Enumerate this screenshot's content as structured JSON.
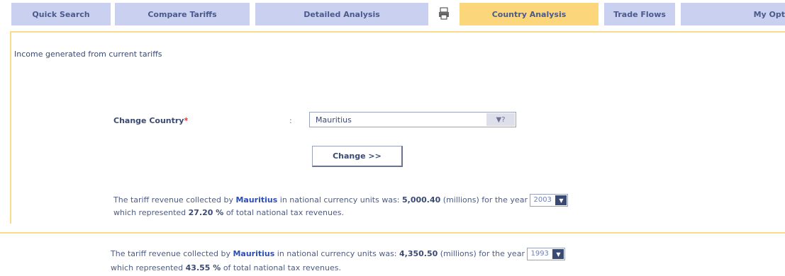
{
  "tabs": {
    "quick_search": "Quick Search",
    "compare_tariffs": "Compare Tariffs",
    "detailed_analysis": "Detailed Analysis",
    "country_analysis": "Country Analysis",
    "trade_flows": "Trade Flows",
    "my_options": "My Opt"
  },
  "panel": {
    "heading": "Income generated from current tariffs",
    "country_label": "Change Country",
    "required_mark": "*",
    "colon": ":",
    "country_value": "Mauritius",
    "change_button": "Change >>"
  },
  "result1": {
    "prefix": "The tariff revenue collected by",
    "country": "Mauritius",
    "middle": "in national currency units was:",
    "amount": "5,000.40",
    "suffix": "(millions) for the year",
    "year": "2003",
    "line2_prefix": "which represented",
    "percent": "27.20 %",
    "line2_suffix": "of total national tax revenues."
  },
  "result2": {
    "prefix": "The tariff revenue collected by",
    "country": "Mauritius",
    "middle": "in national currency units was:",
    "amount": "4,350.50",
    "suffix": "(millions) for the year",
    "year": "1993",
    "line2_prefix": "which represented",
    "percent": "43.55 %",
    "line2_suffix": "of total national tax revenues."
  },
  "colors": {
    "tab_inactive": "#c9d0f0",
    "tab_active": "#fbd67a",
    "panel_border": "#f7dc8a",
    "text": "#3b4a72"
  },
  "icons": {
    "print": "print-icon",
    "dropdown": "chevron-down-icon"
  }
}
